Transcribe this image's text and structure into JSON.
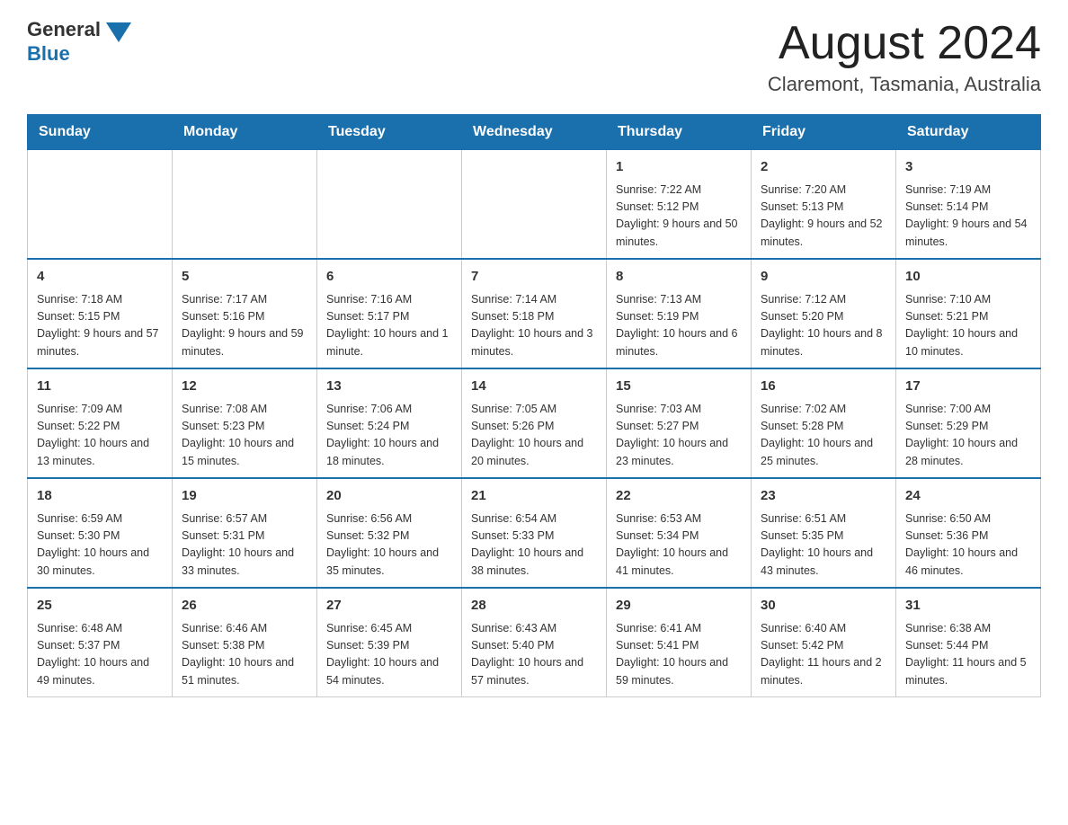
{
  "logo": {
    "text_general": "General",
    "text_blue": "Blue"
  },
  "header": {
    "month_year": "August 2024",
    "location": "Claremont, Tasmania, Australia"
  },
  "days_of_week": [
    "Sunday",
    "Monday",
    "Tuesday",
    "Wednesday",
    "Thursday",
    "Friday",
    "Saturday"
  ],
  "weeks": [
    {
      "days": [
        {
          "number": "",
          "info": ""
        },
        {
          "number": "",
          "info": ""
        },
        {
          "number": "",
          "info": ""
        },
        {
          "number": "",
          "info": ""
        },
        {
          "number": "1",
          "info": "Sunrise: 7:22 AM\nSunset: 5:12 PM\nDaylight: 9 hours and 50 minutes."
        },
        {
          "number": "2",
          "info": "Sunrise: 7:20 AM\nSunset: 5:13 PM\nDaylight: 9 hours and 52 minutes."
        },
        {
          "number": "3",
          "info": "Sunrise: 7:19 AM\nSunset: 5:14 PM\nDaylight: 9 hours and 54 minutes."
        }
      ]
    },
    {
      "days": [
        {
          "number": "4",
          "info": "Sunrise: 7:18 AM\nSunset: 5:15 PM\nDaylight: 9 hours and 57 minutes."
        },
        {
          "number": "5",
          "info": "Sunrise: 7:17 AM\nSunset: 5:16 PM\nDaylight: 9 hours and 59 minutes."
        },
        {
          "number": "6",
          "info": "Sunrise: 7:16 AM\nSunset: 5:17 PM\nDaylight: 10 hours and 1 minute."
        },
        {
          "number": "7",
          "info": "Sunrise: 7:14 AM\nSunset: 5:18 PM\nDaylight: 10 hours and 3 minutes."
        },
        {
          "number": "8",
          "info": "Sunrise: 7:13 AM\nSunset: 5:19 PM\nDaylight: 10 hours and 6 minutes."
        },
        {
          "number": "9",
          "info": "Sunrise: 7:12 AM\nSunset: 5:20 PM\nDaylight: 10 hours and 8 minutes."
        },
        {
          "number": "10",
          "info": "Sunrise: 7:10 AM\nSunset: 5:21 PM\nDaylight: 10 hours and 10 minutes."
        }
      ]
    },
    {
      "days": [
        {
          "number": "11",
          "info": "Sunrise: 7:09 AM\nSunset: 5:22 PM\nDaylight: 10 hours and 13 minutes."
        },
        {
          "number": "12",
          "info": "Sunrise: 7:08 AM\nSunset: 5:23 PM\nDaylight: 10 hours and 15 minutes."
        },
        {
          "number": "13",
          "info": "Sunrise: 7:06 AM\nSunset: 5:24 PM\nDaylight: 10 hours and 18 minutes."
        },
        {
          "number": "14",
          "info": "Sunrise: 7:05 AM\nSunset: 5:26 PM\nDaylight: 10 hours and 20 minutes."
        },
        {
          "number": "15",
          "info": "Sunrise: 7:03 AM\nSunset: 5:27 PM\nDaylight: 10 hours and 23 minutes."
        },
        {
          "number": "16",
          "info": "Sunrise: 7:02 AM\nSunset: 5:28 PM\nDaylight: 10 hours and 25 minutes."
        },
        {
          "number": "17",
          "info": "Sunrise: 7:00 AM\nSunset: 5:29 PM\nDaylight: 10 hours and 28 minutes."
        }
      ]
    },
    {
      "days": [
        {
          "number": "18",
          "info": "Sunrise: 6:59 AM\nSunset: 5:30 PM\nDaylight: 10 hours and 30 minutes."
        },
        {
          "number": "19",
          "info": "Sunrise: 6:57 AM\nSunset: 5:31 PM\nDaylight: 10 hours and 33 minutes."
        },
        {
          "number": "20",
          "info": "Sunrise: 6:56 AM\nSunset: 5:32 PM\nDaylight: 10 hours and 35 minutes."
        },
        {
          "number": "21",
          "info": "Sunrise: 6:54 AM\nSunset: 5:33 PM\nDaylight: 10 hours and 38 minutes."
        },
        {
          "number": "22",
          "info": "Sunrise: 6:53 AM\nSunset: 5:34 PM\nDaylight: 10 hours and 41 minutes."
        },
        {
          "number": "23",
          "info": "Sunrise: 6:51 AM\nSunset: 5:35 PM\nDaylight: 10 hours and 43 minutes."
        },
        {
          "number": "24",
          "info": "Sunrise: 6:50 AM\nSunset: 5:36 PM\nDaylight: 10 hours and 46 minutes."
        }
      ]
    },
    {
      "days": [
        {
          "number": "25",
          "info": "Sunrise: 6:48 AM\nSunset: 5:37 PM\nDaylight: 10 hours and 49 minutes."
        },
        {
          "number": "26",
          "info": "Sunrise: 6:46 AM\nSunset: 5:38 PM\nDaylight: 10 hours and 51 minutes."
        },
        {
          "number": "27",
          "info": "Sunrise: 6:45 AM\nSunset: 5:39 PM\nDaylight: 10 hours and 54 minutes."
        },
        {
          "number": "28",
          "info": "Sunrise: 6:43 AM\nSunset: 5:40 PM\nDaylight: 10 hours and 57 minutes."
        },
        {
          "number": "29",
          "info": "Sunrise: 6:41 AM\nSunset: 5:41 PM\nDaylight: 10 hours and 59 minutes."
        },
        {
          "number": "30",
          "info": "Sunrise: 6:40 AM\nSunset: 5:42 PM\nDaylight: 11 hours and 2 minutes."
        },
        {
          "number": "31",
          "info": "Sunrise: 6:38 AM\nSunset: 5:44 PM\nDaylight: 11 hours and 5 minutes."
        }
      ]
    }
  ]
}
